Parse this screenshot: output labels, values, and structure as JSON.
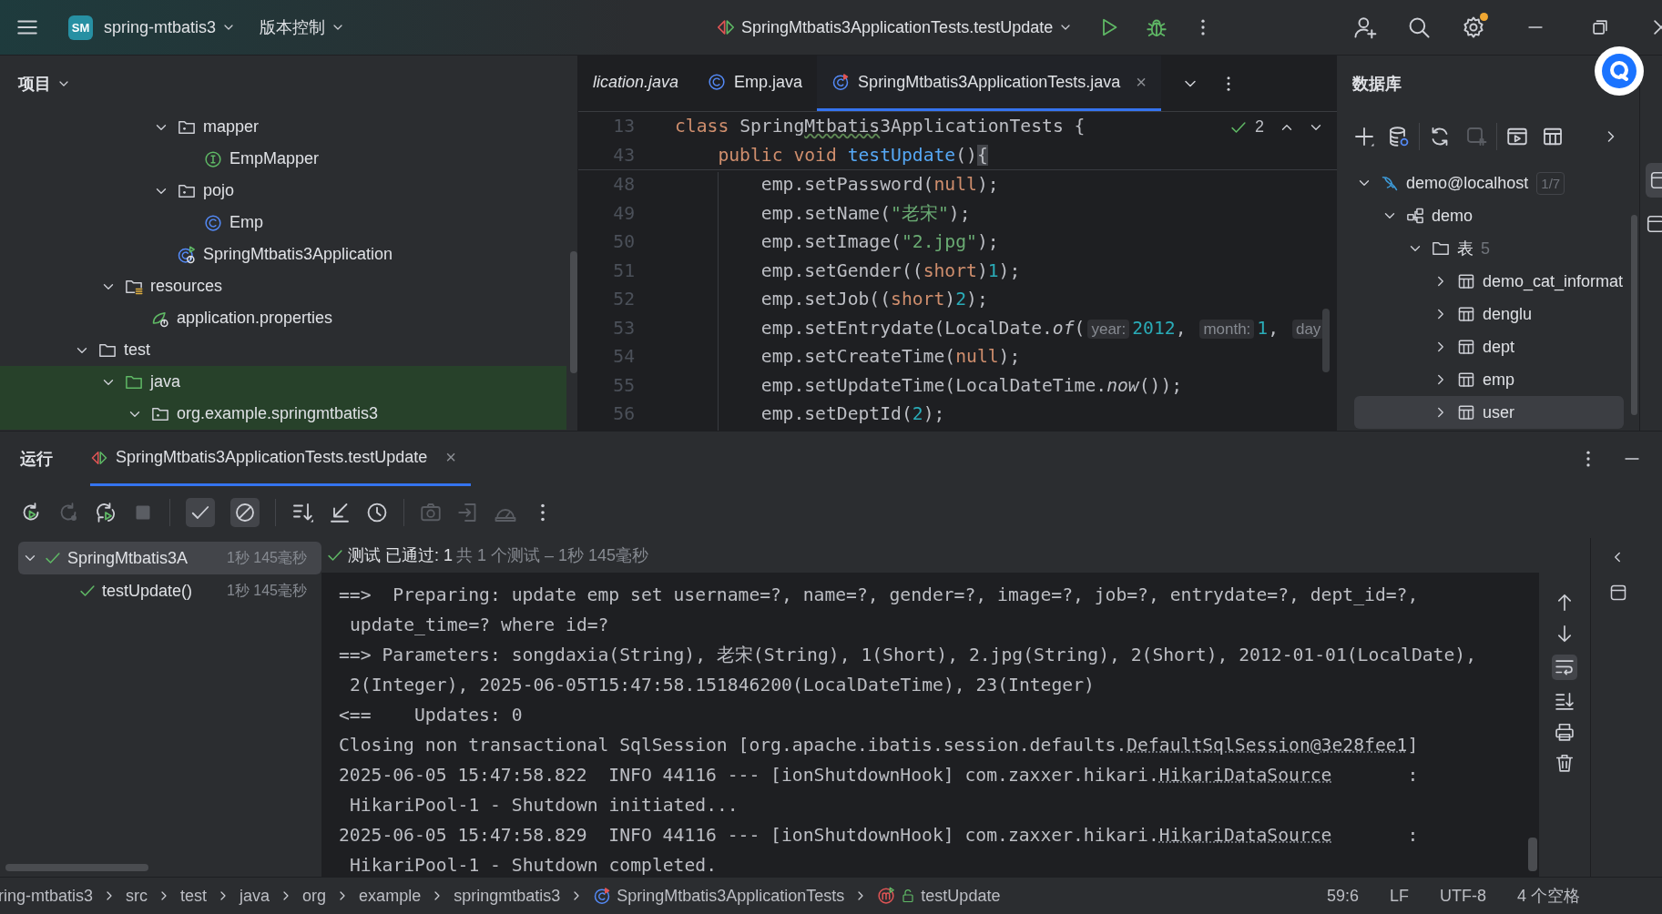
{
  "title_bar": {
    "badge": "SM",
    "project": "spring-mtbatis3",
    "vcs": "版本控制",
    "run_config": "SpringMtbatis3ApplicationTests.testUpdate",
    "settings_notice": true
  },
  "project_panel": {
    "title": "项目",
    "tree": [
      {
        "children": [
          {
            "children": [
              {
                "children": [
                  {
                    "label": "mapper",
                    "kind": "package",
                    "expanded": true,
                    "highlighted": false,
                    "children": [
                      {
                        "label": "EmpMapper",
                        "kind": "interface",
                        "highlighted": false
                      }
                    ]
                  },
                  {
                    "label": "pojo",
                    "kind": "package",
                    "expanded": true,
                    "highlighted": false,
                    "children": [
                      {
                        "label": "Emp",
                        "kind": "class",
                        "highlighted": false
                      }
                    ]
                  },
                  {
                    "label": "SpringMtbatis3Application",
                    "kind": "spring-class",
                    "highlighted": false
                  }
                ]
              }
            ]
          },
          {
            "label": "resources",
            "kind": "resources",
            "expanded": true,
            "highlighted": false,
            "children": [
              {
                "label": "application.properties",
                "kind": "properties",
                "highlighted": false
              }
            ]
          }
        ]
      },
      {
        "label": "test",
        "kind": "folder",
        "expanded": true,
        "highlighted": false,
        "children": [
          {
            "label": "java",
            "kind": "test-folder",
            "expanded": true,
            "highlighted": true,
            "children": [
              {
                "label": "org.example.springmtbatis3",
                "kind": "package",
                "expanded": true,
                "highlighted": true
              }
            ]
          }
        ]
      }
    ]
  },
  "editor": {
    "tabs": [
      {
        "label": "lication.java",
        "preview": true,
        "selected": false
      },
      {
        "label": "Emp.java",
        "kind": "class",
        "preview": false,
        "selected": false
      },
      {
        "label": "SpringMtbatis3ApplicationTests.java",
        "kind": "test-class",
        "preview": false,
        "selected": true,
        "close": "×"
      }
    ],
    "inspection_count": "2",
    "sticky_lines": [
      {
        "number": "13",
        "tokens": [
          {
            "text": "class ",
            "kind": "kw"
          },
          {
            "text": "Spring",
            "kind": "plain"
          },
          {
            "text": "Mtbatis",
            "kind": "typo"
          },
          {
            "text": "3ApplicationTests ",
            "kind": "plain"
          },
          {
            "text": "{",
            "kind": "plain"
          }
        ]
      },
      {
        "number": "43",
        "tokens": [
          {
            "text": "    public void ",
            "kind": "kw"
          },
          {
            "text": "testUpdate",
            "kind": "fn"
          },
          {
            "text": "()",
            "kind": "plain"
          },
          {
            "text": "{",
            "kind": "brace"
          }
        ]
      }
    ],
    "lines": [
      {
        "number": "48",
        "tokens": [
          {
            "text": "        emp.setPassword(",
            "kind": "plain"
          },
          {
            "text": "null",
            "kind": "kw"
          },
          {
            "text": ");",
            "kind": "plain"
          }
        ]
      },
      {
        "number": "49",
        "tokens": [
          {
            "text": "        emp.setName(",
            "kind": "plain"
          },
          {
            "text": "\"老宋\"",
            "kind": "str"
          },
          {
            "text": ");",
            "kind": "plain"
          }
        ]
      },
      {
        "number": "50",
        "tokens": [
          {
            "text": "        emp.setImage(",
            "kind": "plain"
          },
          {
            "text": "\"2.jpg\"",
            "kind": "str"
          },
          {
            "text": ");",
            "kind": "plain"
          }
        ]
      },
      {
        "number": "51",
        "tokens": [
          {
            "text": "        emp.setGender((",
            "kind": "plain"
          },
          {
            "text": "short",
            "kind": "kw"
          },
          {
            "text": ")",
            "kind": "plain"
          },
          {
            "text": "1",
            "kind": "num"
          },
          {
            "text": ");",
            "kind": "plain"
          }
        ]
      },
      {
        "number": "52",
        "tokens": [
          {
            "text": "        emp.setJob((",
            "kind": "plain"
          },
          {
            "text": "short",
            "kind": "kw"
          },
          {
            "text": ")",
            "kind": "plain"
          },
          {
            "text": "2",
            "kind": "num"
          },
          {
            "text": ");",
            "kind": "plain"
          }
        ]
      },
      {
        "number": "53",
        "tokens": [
          {
            "text": "        emp.setEntrydate(LocalDate.",
            "kind": "plain"
          },
          {
            "text": "of",
            "kind": "italic"
          },
          {
            "text": "(",
            "kind": "plain"
          },
          {
            "text": "year:",
            "kind": "hint"
          },
          {
            "text": "2012",
            "kind": "num"
          },
          {
            "text": ", ",
            "kind": "plain"
          },
          {
            "text": "month:",
            "kind": "hint"
          },
          {
            "text": "1",
            "kind": "num"
          },
          {
            "text": ", ",
            "kind": "plain"
          },
          {
            "text": "day",
            "kind": "hint"
          }
        ]
      },
      {
        "number": "54",
        "tokens": [
          {
            "text": "        emp.setCreateTime(",
            "kind": "plain"
          },
          {
            "text": "null",
            "kind": "kw"
          },
          {
            "text": ");",
            "kind": "plain"
          }
        ]
      },
      {
        "number": "55",
        "tokens": [
          {
            "text": "        emp.setUpdateTime(LocalDateTime.",
            "kind": "plain"
          },
          {
            "text": "now",
            "kind": "italic"
          },
          {
            "text": "());",
            "kind": "plain"
          }
        ]
      },
      {
        "number": "56",
        "tokens": [
          {
            "text": "        emp.setDeptId(",
            "kind": "plain"
          },
          {
            "text": "2",
            "kind": "num"
          },
          {
            "text": ");",
            "kind": "plain"
          }
        ]
      }
    ]
  },
  "database_panel": {
    "title": "数据库",
    "tree": [
      {
        "label": "demo@localhost",
        "kind": "mysql",
        "badge": "1/7",
        "expanded": true,
        "selected": false,
        "children": [
          {
            "label": "demo",
            "kind": "schema",
            "expanded": true,
            "selected": false,
            "children": [
              {
                "label": "表",
                "kind": "folder",
                "count": "5",
                "expanded": true,
                "selected": false,
                "children": [
                  {
                    "label": "demo_cat_informat",
                    "kind": "table",
                    "expanded": false,
                    "selected": false
                  },
                  {
                    "label": "denglu",
                    "kind": "table",
                    "expanded": false,
                    "selected": false
                  },
                  {
                    "label": "dept",
                    "kind": "table",
                    "expanded": false,
                    "selected": false
                  },
                  {
                    "label": "emp",
                    "kind": "table",
                    "expanded": false,
                    "selected": false
                  },
                  {
                    "label": "user",
                    "kind": "table",
                    "expanded": false,
                    "selected": true
                  }
                ]
              }
            ]
          }
        ]
      }
    ]
  },
  "run_panel": {
    "title": "运行",
    "tab": {
      "label": "SpringMtbatis3ApplicationTests.testUpdate",
      "close": "×"
    },
    "toolbar": [
      {
        "kind": "rerun",
        "disabled": false,
        "toggled": false
      },
      {
        "kind": "rerun-failed",
        "disabled": true,
        "toggled": false
      },
      {
        "kind": "rerun-auto",
        "disabled": false,
        "toggled": false
      },
      {
        "kind": "stop",
        "disabled": true,
        "toggled": false
      },
      {
        "kind": "separator"
      },
      {
        "kind": "show-passed",
        "disabled": false,
        "toggled": true
      },
      {
        "kind": "show-ignored",
        "disabled": false,
        "toggled": true
      },
      {
        "kind": "separator"
      },
      {
        "kind": "sort",
        "disabled": false,
        "toggled": false
      },
      {
        "kind": "collapse",
        "disabled": false,
        "toggled": false
      },
      {
        "kind": "history",
        "disabled": false,
        "toggled": false
      },
      {
        "kind": "separator"
      },
      {
        "kind": "snapshot",
        "disabled": true,
        "toggled": false
      },
      {
        "kind": "export",
        "disabled": true,
        "toggled": false
      },
      {
        "kind": "profile",
        "disabled": true,
        "toggled": false
      },
      {
        "kind": "more",
        "disabled": false,
        "toggled": false
      }
    ],
    "tests": [
      {
        "label": "SpringMtbatis3A",
        "time": "1秒 145毫秒",
        "kind": "passed",
        "selected": true,
        "expanded": true,
        "children": [
          {
            "label": "testUpdate()",
            "time": "1秒 145毫秒",
            "kind": "passed",
            "selected": false
          }
        ]
      }
    ],
    "result": {
      "kind": "passed",
      "label": "测试 已通过: 1",
      "summary": "共 1 个测试 – 1秒 145毫秒"
    },
    "console": [
      {
        "wrapped": false,
        "segments": [
          {
            "text": "==>  Preparing: update emp set username=?, name=?, gender=?, image=?, job=?, entrydate=?, dept_id=?,",
            "kind": "plain"
          }
        ]
      },
      {
        "wrapped": true,
        "segments": [
          {
            "text": "update_time=? where id=?",
            "kind": "plain"
          }
        ]
      },
      {
        "wrapped": false,
        "segments": [
          {
            "text": "==> Parameters: songdaxia(String), 老宋(String), 1(Short), 2.jpg(String), 2(Short), 2012-01-01(LocalDate),",
            "kind": "plain"
          }
        ]
      },
      {
        "wrapped": true,
        "segments": [
          {
            "text": "2(Integer), 2025-06-05T15:47:58.151846200(LocalDateTime), 23(Integer)",
            "kind": "plain"
          }
        ]
      },
      {
        "wrapped": false,
        "segments": [
          {
            "text": "<==    Updates: 0",
            "kind": "plain"
          }
        ]
      },
      {
        "wrapped": false,
        "segments": [
          {
            "text": "Closing non transactional SqlSession [org.apache.ibatis.session.defaults.",
            "kind": "plain"
          },
          {
            "text": "DefaultSqlSession@3e28fee1",
            "kind": "link"
          },
          {
            "text": "]",
            "kind": "plain"
          }
        ]
      },
      {
        "wrapped": false,
        "segments": [
          {
            "text": "2025-06-05 15:47:58.822  INFO 44116 --- [ionShutdownHook] com.zaxxer.hikari.",
            "kind": "plain"
          },
          {
            "text": "HikariDataSource",
            "kind": "link"
          },
          {
            "text": "       :",
            "kind": "plain"
          }
        ]
      },
      {
        "wrapped": true,
        "segments": [
          {
            "text": "HikariPool-1 - Shutdown initiated...",
            "kind": "plain"
          }
        ]
      },
      {
        "wrapped": false,
        "segments": [
          {
            "text": "2025-06-05 15:47:58.829  INFO 44116 --- [ionShutdownHook] com.zaxxer.hikari.",
            "kind": "plain"
          },
          {
            "text": "HikariDataSource",
            "kind": "link"
          },
          {
            "text": "       :",
            "kind": "plain"
          }
        ]
      },
      {
        "wrapped": true,
        "segments": [
          {
            "text": "HikariPool-1 - Shutdown completed.",
            "kind": "plain"
          }
        ]
      }
    ],
    "console_tools": [
      {
        "kind": "up",
        "toggled": false
      },
      {
        "kind": "down",
        "toggled": false
      },
      {
        "kind": "wrap",
        "toggled": true
      },
      {
        "kind": "scroll-end",
        "toggled": false
      },
      {
        "kind": "print",
        "toggled": false
      },
      {
        "kind": "clear",
        "toggled": false
      }
    ]
  },
  "status_bar": {
    "breadcrumbs": [
      {
        "label": "ring-mtbatis3"
      },
      {
        "label": "src"
      },
      {
        "label": "test"
      },
      {
        "label": "java"
      },
      {
        "label": "org"
      },
      {
        "label": "example"
      },
      {
        "label": "springmtbatis3"
      },
      {
        "label": "SpringMtbatis3ApplicationTests",
        "kind": "test-class"
      },
      {
        "label": "testUpdate",
        "kind": "test-method"
      }
    ],
    "position": "59:6",
    "line_ending": "LF",
    "encoding": "UTF-8",
    "indent": "4 个空格"
  }
}
